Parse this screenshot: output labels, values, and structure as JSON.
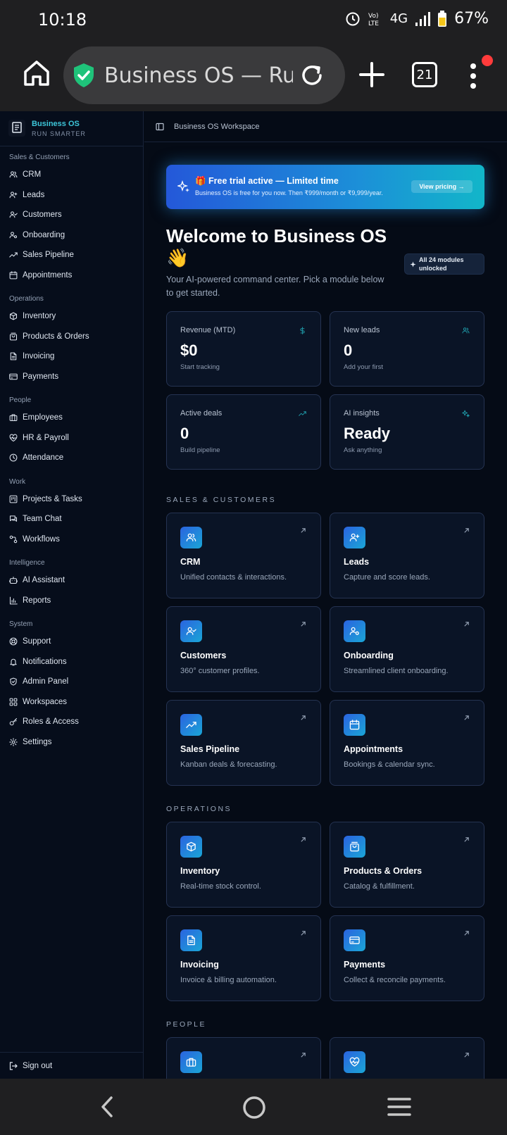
{
  "status": {
    "time": "10:18",
    "network": "4G",
    "battery": "67%"
  },
  "browser": {
    "url_title": "Business OS — Ru…",
    "tab_count": "21"
  },
  "brand": {
    "name": "Business OS",
    "tagline": "RUN SMARTER"
  },
  "sidebar": {
    "sections": [
      {
        "title": "Sales & Customers",
        "items": [
          {
            "label": "CRM",
            "icon": "users-icon"
          },
          {
            "label": "Leads",
            "icon": "user-plus-icon"
          },
          {
            "label": "Customers",
            "icon": "user-check-icon"
          },
          {
            "label": "Onboarding",
            "icon": "user-cog-icon"
          },
          {
            "label": "Sales Pipeline",
            "icon": "trend-icon"
          },
          {
            "label": "Appointments",
            "icon": "calendar-icon"
          }
        ]
      },
      {
        "title": "Operations",
        "items": [
          {
            "label": "Inventory",
            "icon": "box-icon"
          },
          {
            "label": "Products & Orders",
            "icon": "bag-icon"
          },
          {
            "label": "Invoicing",
            "icon": "file-icon"
          },
          {
            "label": "Payments",
            "icon": "card-icon"
          }
        ]
      },
      {
        "title": "People",
        "items": [
          {
            "label": "Employees",
            "icon": "briefcase-icon"
          },
          {
            "label": "HR & Payroll",
            "icon": "heart-pulse-icon"
          },
          {
            "label": "Attendance",
            "icon": "clock-icon"
          }
        ]
      },
      {
        "title": "Work",
        "items": [
          {
            "label": "Projects & Tasks",
            "icon": "kanban-icon"
          },
          {
            "label": "Team Chat",
            "icon": "chat-icon"
          },
          {
            "label": "Workflows",
            "icon": "workflow-icon"
          }
        ]
      },
      {
        "title": "Intelligence",
        "items": [
          {
            "label": "AI Assistant",
            "icon": "bot-icon"
          },
          {
            "label": "Reports",
            "icon": "bar-chart-icon"
          }
        ]
      },
      {
        "title": "System",
        "items": [
          {
            "label": "Support",
            "icon": "lifebuoy-icon"
          },
          {
            "label": "Notifications",
            "icon": "bell-icon"
          },
          {
            "label": "Admin Panel",
            "icon": "shield-icon"
          },
          {
            "label": "Workspaces",
            "icon": "grid-icon"
          },
          {
            "label": "Roles & Access",
            "icon": "key-icon"
          },
          {
            "label": "Settings",
            "icon": "gear-icon"
          }
        ]
      }
    ],
    "signout": "Sign out"
  },
  "topbar": {
    "title": "Business OS Workspace"
  },
  "trial": {
    "title": "🎁 Free trial active — Limited time",
    "subtitle": "Business OS is free for you now. Then ₹999/month or ₹9,999/year.",
    "button": "View pricing →"
  },
  "welcome": {
    "title": "Welcome to Business OS 👋",
    "subtitle": "Your AI-powered command center. Pick a module below to get started.",
    "badge": "All 24 modules unlocked"
  },
  "stats": [
    {
      "label": "Revenue (MTD)",
      "value": "$0",
      "hint": "Start tracking",
      "icon": "dollar-icon"
    },
    {
      "label": "New leads",
      "value": "0",
      "hint": "Add your first",
      "icon": "users-icon"
    },
    {
      "label": "Active deals",
      "value": "0",
      "hint": "Build pipeline",
      "icon": "trend-icon"
    },
    {
      "label": "AI insights",
      "value": "Ready",
      "hint": "Ask anything",
      "icon": "sparkles-icon"
    }
  ],
  "groups": [
    {
      "title": "SALES & CUSTOMERS",
      "modules": [
        {
          "title": "CRM",
          "desc": "Unified contacts & interactions.",
          "icon": "users-icon"
        },
        {
          "title": "Leads",
          "desc": "Capture and score leads.",
          "icon": "user-plus-icon"
        },
        {
          "title": "Customers",
          "desc": "360° customer profiles.",
          "icon": "user-check-icon"
        },
        {
          "title": "Onboarding",
          "desc": "Streamlined client onboarding.",
          "icon": "user-cog-icon"
        },
        {
          "title": "Sales Pipeline",
          "desc": "Kanban deals & forecasting.",
          "icon": "trend-icon"
        },
        {
          "title": "Appointments",
          "desc": "Bookings & calendar sync.",
          "icon": "calendar-icon"
        }
      ]
    },
    {
      "title": "OPERATIONS",
      "modules": [
        {
          "title": "Inventory",
          "desc": "Real-time stock control.",
          "icon": "box-icon"
        },
        {
          "title": "Products & Orders",
          "desc": "Catalog & fulfillment.",
          "icon": "bag-icon"
        },
        {
          "title": "Invoicing",
          "desc": "Invoice & billing automation.",
          "icon": "file-icon"
        },
        {
          "title": "Payments",
          "desc": "Collect & reconcile payments.",
          "icon": "card-icon"
        }
      ]
    },
    {
      "title": "PEOPLE",
      "modules": [
        {
          "title": "",
          "desc": "",
          "icon": "briefcase-icon"
        },
        {
          "title": "",
          "desc": "",
          "icon": "heart-pulse-icon"
        }
      ]
    }
  ],
  "colors": {
    "accent": "#3dc6d9",
    "card_bg": "#0a1426",
    "card_border": "#253352",
    "bg": "#050b16"
  }
}
